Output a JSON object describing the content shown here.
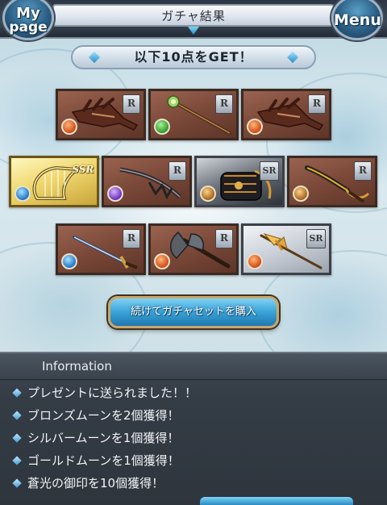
{
  "header": {
    "title": "ガチャ結果",
    "mypage_line1": "My",
    "mypage_line2": "page",
    "menu_label": "Menu"
  },
  "banner": {
    "text": "以下10点をGET！"
  },
  "items": [
    {
      "rarity": "R",
      "element": "fire",
      "weapon": "claw"
    },
    {
      "rarity": "R",
      "element": "wind",
      "weapon": "staff"
    },
    {
      "rarity": "R",
      "element": "fire",
      "weapon": "claw"
    },
    {
      "rarity": "SSR",
      "element": "water",
      "weapon": "harp"
    },
    {
      "rarity": "R",
      "element": "dark",
      "weapon": "bow"
    },
    {
      "rarity": "SR",
      "element": "earth",
      "weapon": "gauntlet"
    },
    {
      "rarity": "R",
      "element": "earth",
      "weapon": "saber"
    },
    {
      "rarity": "R",
      "element": "water",
      "weapon": "sword"
    },
    {
      "rarity": "R",
      "element": "fire",
      "weapon": "axe"
    },
    {
      "rarity": "SR",
      "element": "fire",
      "weapon": "spear"
    }
  ],
  "action_button": {
    "label": "続けてガチャセットを購入"
  },
  "information": {
    "heading": "Information",
    "lines": [
      "プレゼントに送られました！！",
      "ブロンズムーンを2個獲得！",
      "シルバームーンを1個獲得！",
      "ゴールドムーンを1個獲得！",
      "蒼光の御印を10個獲得！"
    ]
  },
  "colors": {
    "accent_blue": "#3aa2d6",
    "panel_dark": "#343c45",
    "card_r": "#7a4838",
    "card_sr": "#c9cfd7",
    "card_ssr": "#f0d870"
  }
}
